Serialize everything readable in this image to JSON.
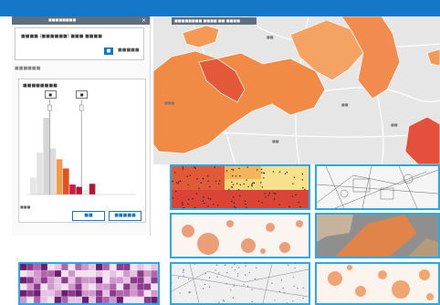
{
  "app": {
    "map_title": "■■■■■■■■ ■■■■ ■■ ■■■■",
    "panel_title": "■■■■■■■■",
    "close_glyph": "×"
  },
  "selection": {
    "field_text": "■■■■ (■■■■■■) ■■■ ■■■■",
    "apply_label": "■",
    "link_label": "■■■■■"
  },
  "histogram": {
    "section_label": "■■■■■■",
    "title": "■■■■■■■■",
    "handle_low": "■",
    "handle_high": "■",
    "footnote": "■■■",
    "ok_label": "■■",
    "cancel_label": "■■■■■",
    "bars": [
      {
        "value": 0.22,
        "color": "#e6e6e6"
      },
      {
        "value": 0.55,
        "color": "#e3e3e3"
      },
      {
        "value": 1.0,
        "color": "#d6d6d6"
      },
      {
        "value": 0.6,
        "color": "#dcdcdc"
      },
      {
        "value": 0.46,
        "color": "#f39a4a"
      },
      {
        "value": 0.34,
        "color": "#e5501c"
      },
      {
        "value": 0.13,
        "color": "#c81e46"
      },
      {
        "value": 0.1,
        "color": "#b31636"
      },
      {
        "value": 0.06,
        "color": "#ececec"
      },
      {
        "value": 0.14,
        "color": "#b31636"
      }
    ],
    "low_handle_fraction": 0.3,
    "high_handle_fraction": 0.78
  },
  "map": {
    "districts": [
      {
        "id": "d1",
        "color": "#f59a55"
      },
      {
        "id": "d2",
        "color": "#f08a45"
      },
      {
        "id": "d3",
        "color": "#e4583a"
      },
      {
        "id": "d4",
        "color": "#f4a362"
      },
      {
        "id": "d5",
        "color": "#f28b4f"
      },
      {
        "id": "d6",
        "color": "#e5503c"
      }
    ],
    "place_labels": [
      "■■",
      "■■",
      "■■",
      "■■■",
      "■■"
    ]
  },
  "thumbnails": [
    {
      "name": "dot-density",
      "accent": "#e0533a"
    },
    {
      "name": "street-lines",
      "accent": "#555555"
    },
    {
      "name": "proportional-circles",
      "accent": "#e27a55"
    },
    {
      "name": "dark-terrain",
      "accent": "#a28060"
    },
    {
      "name": "purple-grid",
      "accent": "#7a2a7e"
    },
    {
      "name": "dot-roads",
      "accent": "#5566aa"
    },
    {
      "name": "orange-circles",
      "accent": "#f0975a"
    }
  ]
}
